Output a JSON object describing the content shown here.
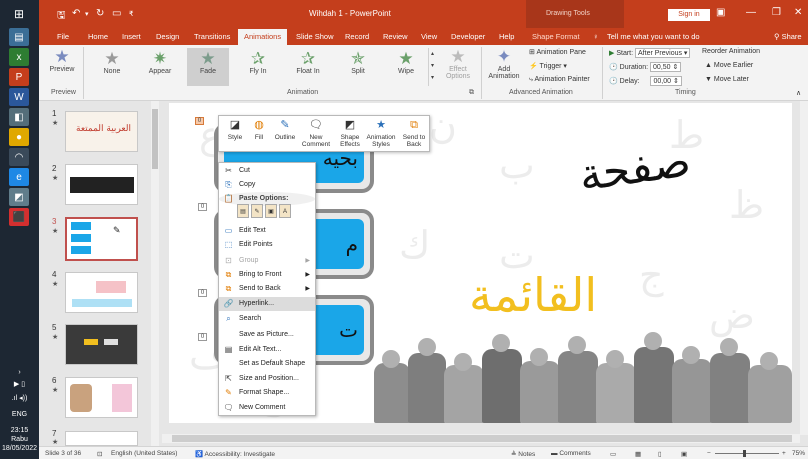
{
  "taskbar": {
    "time": "23:15",
    "day": "Rabu",
    "date": "18/05/2022",
    "lang": "ENG"
  },
  "titlebar": {
    "title": "Wihdah 1  -  PowerPoint",
    "context_group": "Drawing Tools",
    "signin": "Sign in"
  },
  "tabs": [
    "File",
    "Home",
    "Insert",
    "Design",
    "Transitions",
    "Animations",
    "Slide Show",
    "Record",
    "Review",
    "View",
    "Developer",
    "Help",
    "Shape Format"
  ],
  "active_tab": "Animations",
  "tell_me": "Tell me what you want to do",
  "share": "Share",
  "ribbon": {
    "preview": "Preview",
    "preview_group": "Preview",
    "animations": [
      "None",
      "Appear",
      "Fade",
      "Fly In",
      "Float In",
      "Split",
      "Wipe"
    ],
    "effect_options": "Effect Options",
    "animation_group": "Animation",
    "add_animation": "Add Animation",
    "animation_pane": "Animation Pane",
    "trigger": "Trigger",
    "animation_painter": "Animation Painter",
    "advanced_group": "Advanced Animation",
    "start_label": "Start:",
    "start_value": "After Previous",
    "duration_label": "Duration:",
    "duration_value": "00,50",
    "delay_label": "Delay:",
    "delay_value": "00,00",
    "reorder": "Reorder Animation",
    "move_earlier": "Move Earlier",
    "move_later": "Move Later",
    "timing_group": "Timing"
  },
  "thumbnails": [
    {
      "num": "1",
      "text": "العربية الممتعة"
    },
    {
      "num": "2",
      "text": ""
    },
    {
      "num": "3",
      "text": ""
    },
    {
      "num": "4",
      "text": ""
    },
    {
      "num": "5",
      "text": ""
    },
    {
      "num": "6",
      "text": ""
    },
    {
      "num": "7",
      "text": ""
    }
  ],
  "slide": {
    "word_black": "صفحة",
    "word_gold": "القائمة",
    "box_texts": [
      "بحيه",
      "م",
      "ت"
    ],
    "anim_tags": [
      "0",
      "0",
      "0",
      "0"
    ]
  },
  "mini_toolbar": [
    "Style",
    "Fill",
    "Outline",
    "New Comment",
    "Shape Effects",
    "Animation Styles",
    "Send to Back"
  ],
  "context_menu": {
    "cut": "Cut",
    "copy": "Copy",
    "paste_options": "Paste Options:",
    "edit_text": "Edit Text",
    "edit_points": "Edit Points",
    "group": "Group",
    "bring_to_front": "Bring to Front",
    "send_to_back": "Send to Back",
    "hyperlink": "Hyperlink...",
    "search": "Search",
    "save_as_picture": "Save as Picture...",
    "edit_alt_text": "Edit Alt Text...",
    "set_default_shape": "Set as Default Shape",
    "size_position": "Size and Position...",
    "format_shape": "Format Shape...",
    "new_comment": "New Comment"
  },
  "status": {
    "slide_info": "Slide 3 of 36",
    "language": "English (United States)",
    "accessibility": "Accessibility: Investigate",
    "notes": "Notes",
    "comments": "Comments",
    "zoom": "75%"
  },
  "colors": {
    "accent": "#c43e1c",
    "blue_box": "#1aa6e8",
    "gold": "#f2bf1f"
  }
}
